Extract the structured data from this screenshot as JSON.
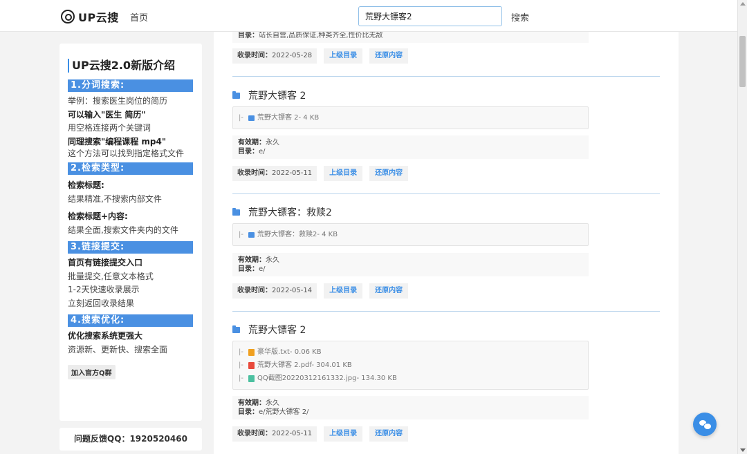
{
  "header": {
    "logo_text": "UP云搜",
    "nav_home": "首页",
    "search_value": "荒野大镖客2",
    "search_button": "搜索"
  },
  "sidebar": {
    "title": "UP云搜2.0新版介绍",
    "sections": [
      {
        "head": "1.分词搜索:",
        "lines": [
          "举例：搜索医生岗位的简历",
          "可以输入\"医生 简历\"",
          "用空格连接两个关键词",
          "同理搜索\"编程课程 mp4\"",
          "这个方法可以找到指定格式文件"
        ]
      },
      {
        "head": "2.检索类型:",
        "lines": [
          "检索标题:",
          "结果精准,不搜索内部文件",
          "检索标题+内容:",
          "结果全面,搜索文件夹内的文件"
        ]
      },
      {
        "head": "3.链接提交:",
        "lines": [
          "首页有链接提交入口",
          "批量提交,任意文本格式",
          "1-2天快速收录展示",
          "立刻返回收录结果"
        ]
      },
      {
        "head": "4.搜索优化:",
        "lines": [
          "优化搜索系统更强大",
          "资源新、更新快、搜索全面"
        ]
      }
    ],
    "join_button": "加入官方Q群",
    "feedback": "问题反馈QQ：1920520460"
  },
  "labels": {
    "dir": "目录：",
    "validity": "有效期：",
    "time": "收录时间：",
    "parent": "上级目录",
    "restore": "还原内容"
  },
  "top_fragment": {
    "dir_value": "站长自营,品质保证,种类齐全,性价比无敌",
    "time_value": "2022-05-28"
  },
  "results": [
    {
      "title": "荒野大镖客 2",
      "files": [
        "荒野大镖客 2- 4 KB"
      ],
      "validity": "永久",
      "dir": "e/",
      "time": "2022-05-11"
    },
    {
      "title": "荒野大镖客：救赎2",
      "files": [
        "荒野大镖客：救赎2- 4 KB"
      ],
      "validity": "永久",
      "dir": "e/",
      "time": "2022-05-14"
    },
    {
      "title": "荒野大镖客 2",
      "files": [
        "豪华版.txt- 0.06 KB",
        "荒野大镖客 2.pdf- 304.01 KB",
        "QQ截图20220312161332.jpg- 134.30 KB"
      ],
      "validity": "永久",
      "dir": "e/荒野大镖客 2/",
      "time": "2022-05-11"
    }
  ],
  "icons": {
    "float_button": "wechat-icon"
  },
  "colors": {
    "accent": "#4a90e2",
    "link": "#3a8ee6"
  }
}
